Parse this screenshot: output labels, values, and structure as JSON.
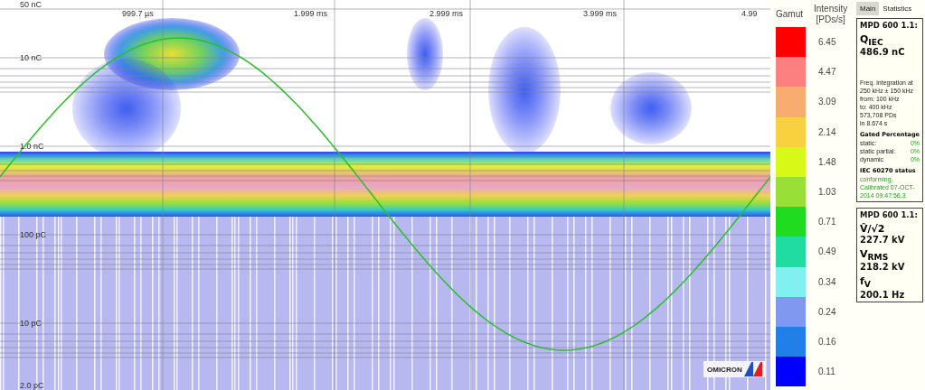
{
  "plot": {
    "y_labels": [
      "50 nC",
      "10 nC",
      "1.0 nC",
      "100 pC",
      "10 pC",
      "2.0 pC"
    ],
    "x_labels": [
      "999.7 µs",
      "1.999 ms",
      "2.999 ms",
      "3.999 ms",
      "4.99"
    ],
    "logo": "OMICRON"
  },
  "legend": {
    "title": "Gamut",
    "unit_title": "Intensity",
    "unit": "[PDs/s]",
    "items": [
      {
        "label": "6.45",
        "color": "#ff0000"
      },
      {
        "label": "4.47",
        "color": "#fc8080"
      },
      {
        "label": "3.09",
        "color": "#f8ac70"
      },
      {
        "label": "2.14",
        "color": "#f8d040"
      },
      {
        "label": "1.48",
        "color": "#d8f818"
      },
      {
        "label": "1.03",
        "color": "#98e038"
      },
      {
        "label": "0.71",
        "color": "#20dc20"
      },
      {
        "label": "0.49",
        "color": "#20dca0"
      },
      {
        "label": "0.34",
        "color": "#80f0f0"
      },
      {
        "label": "0.24",
        "color": "#8098f0"
      },
      {
        "label": "0.16",
        "color": "#2080e8"
      },
      {
        "label": "0.11",
        "color": "#0000ff"
      }
    ]
  },
  "tabs": [
    {
      "label": "Main",
      "selected": true
    },
    {
      "label": "Statistics",
      "selected": false
    }
  ],
  "charge_box": {
    "title": "MPD 600 1.1:",
    "quantity": "Q$_{IEC}$",
    "value": "486.9 nC",
    "info": [
      "Freq. integration at",
      "250 kHz ± 150 kHz",
      "from:  100 kHz",
      "to:     400 kHz",
      "573,708 PDs",
      "in 8.674 s"
    ],
    "gated_title": "Gated Percentage",
    "gated": [
      {
        "label": "static:",
        "value": "0%"
      },
      {
        "label": "static partial:",
        "value": "0%"
      },
      {
        "label": "dynamic",
        "value": "0%"
      }
    ],
    "status_title": "IEC 60270 status",
    "status": "conforming. Calibrated 07-OCT-2014 09:47:56.3"
  },
  "voltage_box": {
    "title": "MPD 600 1.1:",
    "readings": [
      {
        "quantity": "V̂/√2",
        "value": "227.7 kV"
      },
      {
        "quantity": "V$_{RMS}$",
        "value": "218.2 kV"
      },
      {
        "quantity": "f$_{V}$",
        "value": "200.1 Hz"
      }
    ]
  }
}
